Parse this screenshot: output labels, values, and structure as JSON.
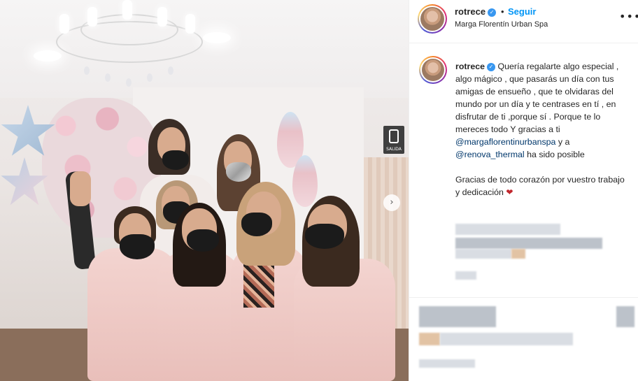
{
  "post": {
    "username": "rotrece",
    "follow_label": "Seguir",
    "separator": "•",
    "location": "Marga Florentín Urban Spa",
    "more_label": "•••",
    "carousel_next": "›"
  },
  "caption": {
    "username": "rotrece",
    "text_part1": "Quería regalarte algo especial , algo mágico , que pasarás un día con tus amigas de ensueño , que te olvidaras del mundo por un día y te centrases en tí , en disfrutar de ti ,porque sí . Porque te lo mereces todo Y gracias a ti ",
    "mention1": "@margaflorentinurbanspa",
    "text_part2": " y a ",
    "mention2": "@renova_thermal",
    "text_part3": " ha sido posible",
    "text_part4": "Gracias de todo corazón por vuestro trabajo y dedicación ",
    "heart": "❤"
  },
  "photo": {
    "exit_sign": "SALIDA"
  },
  "colors": {
    "link": "#0095f6",
    "mention": "#00376b",
    "verified": "#3897f0"
  },
  "icons": [
    "verified-badge-icon",
    "more-options-icon",
    "chevron-right-icon",
    "heart-emoji-icon"
  ]
}
